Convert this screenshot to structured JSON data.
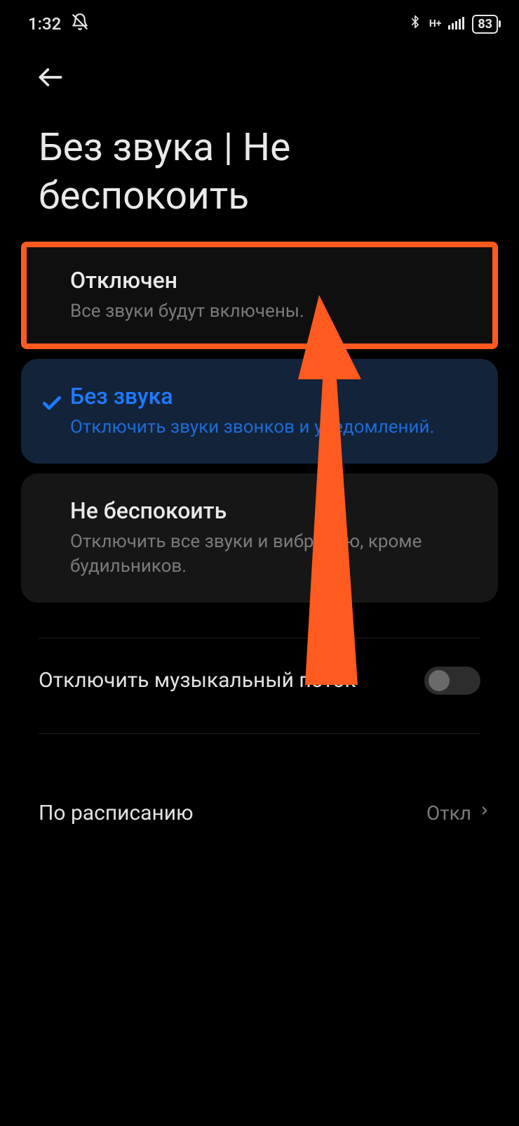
{
  "status": {
    "time": "1:32",
    "battery": "83"
  },
  "page": {
    "title": "Без звука | Не беспокоить"
  },
  "options": [
    {
      "title": "Отключен",
      "subtitle": "Все звуки будут включены."
    },
    {
      "title": "Без звука",
      "subtitle": "Отключить звуки звонков и уведомлений."
    },
    {
      "title": "Не беспокоить",
      "subtitle": "Отключить все звуки и вибрацию, кроме будильников."
    }
  ],
  "rows": {
    "mute_stream": {
      "label": "Отключить музыкальный поток"
    },
    "schedule": {
      "label": "По расписанию",
      "value": "Откл"
    }
  }
}
